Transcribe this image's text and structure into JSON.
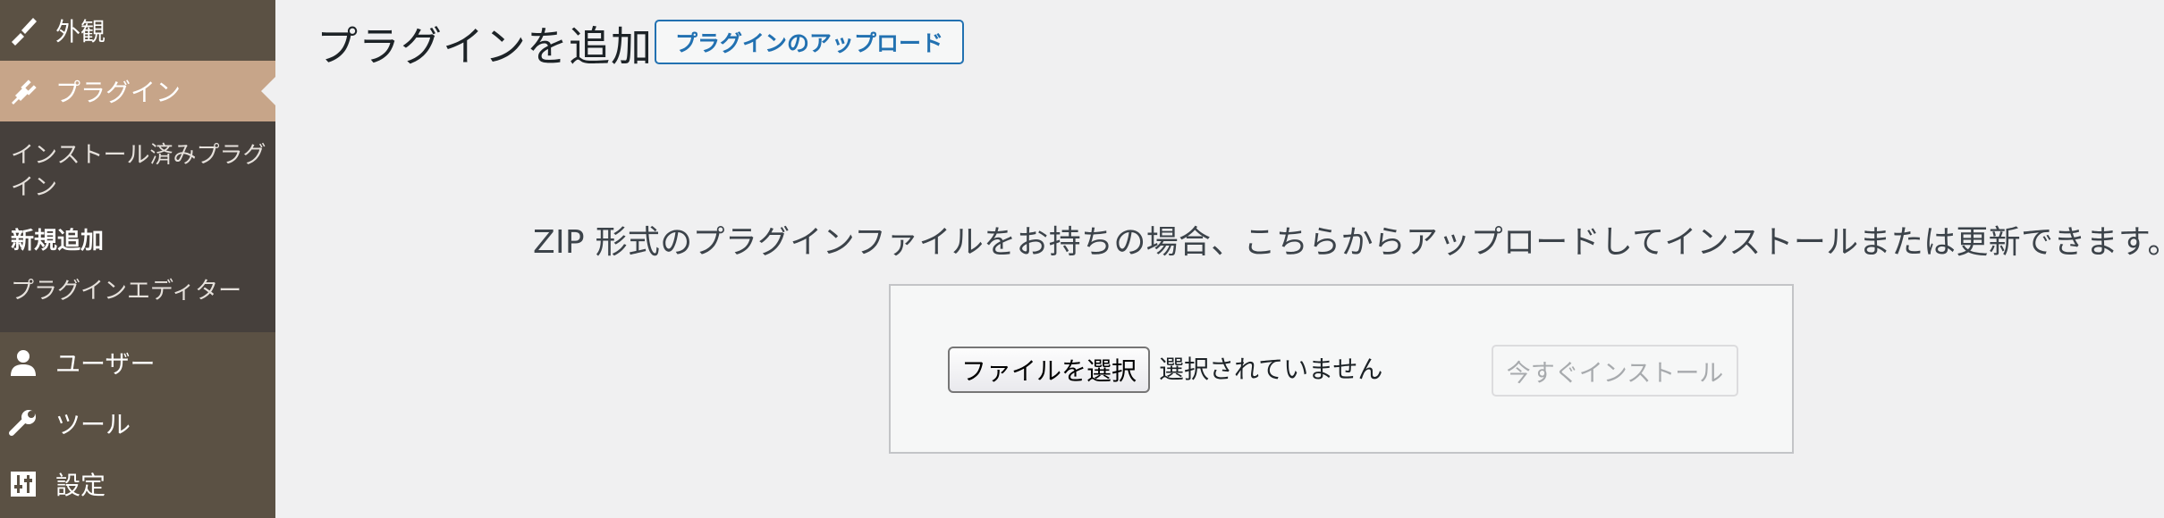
{
  "sidebar": {
    "appearance": {
      "label": "外観",
      "icon": "paintbrush-icon"
    },
    "plugins": {
      "label": "プラグイン",
      "icon": "plugin-icon"
    },
    "submenu": {
      "installed": "インストール済みプラグイン",
      "add_new": "新規追加",
      "editor": "プラグインエディター"
    },
    "users": {
      "label": "ユーザー",
      "icon": "user-icon"
    },
    "tools": {
      "label": "ツール",
      "icon": "wrench-icon"
    },
    "settings": {
      "label": "設定",
      "icon": "settings-icon"
    }
  },
  "main": {
    "title": "プラグインを追加",
    "upload_toggle_label": "プラグインのアップロード",
    "upload_description": "ZIP 形式のプラグインファイルをお持ちの場合、こちらからアップロードしてインストールまたは更新できます。",
    "file_button_label": "ファイルを選択",
    "file_status": "選択されていません",
    "install_button_label": "今すぐインストール"
  },
  "colors": {
    "sidebar_bg": "#5b5144",
    "submenu_bg": "#46403c",
    "active_menu_bg": "#c7a589",
    "accent_blue": "#2271b1",
    "page_bg": "#f0f0f1"
  }
}
